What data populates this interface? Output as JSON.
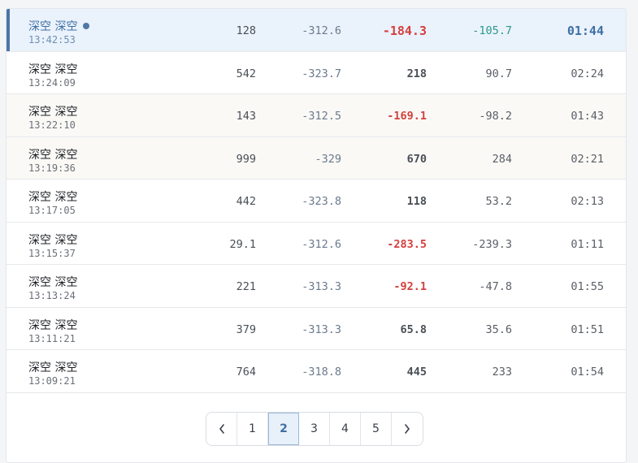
{
  "rows": [
    {
      "name": "深空 深空",
      "time": "13:42:53",
      "c1": "128",
      "c2": "-312.6",
      "c3": "-184.3",
      "c4": "-105.7",
      "c5": "01:44"
    },
    {
      "name": "深空 深空",
      "time": "13:24:09",
      "c1": "542",
      "c2": "-323.7",
      "c3": "218",
      "c4": "90.7",
      "c5": "02:24"
    },
    {
      "name": "深空 深空",
      "time": "13:22:10",
      "c1": "143",
      "c2": "-312.5",
      "c3": "-169.1",
      "c4": "-98.2",
      "c5": "01:43"
    },
    {
      "name": "深空 深空",
      "time": "13:19:36",
      "c1": "999",
      "c2": "-329",
      "c3": "670",
      "c4": "284",
      "c5": "02:21"
    },
    {
      "name": "深空 深空",
      "time": "13:17:05",
      "c1": "442",
      "c2": "-323.8",
      "c3": "118",
      "c4": "53.2",
      "c5": "02:13"
    },
    {
      "name": "深空 深空",
      "time": "13:15:37",
      "c1": "29.1",
      "c2": "-312.6",
      "c3": "-283.5",
      "c4": "-239.3",
      "c5": "01:11"
    },
    {
      "name": "深空 深空",
      "time": "13:13:24",
      "c1": "221",
      "c2": "-313.3",
      "c3": "-92.1",
      "c4": "-47.8",
      "c5": "01:55"
    },
    {
      "name": "深空 深空",
      "time": "13:11:21",
      "c1": "379",
      "c2": "-313.3",
      "c3": "65.8",
      "c4": "35.6",
      "c5": "01:51"
    },
    {
      "name": "深空 深空",
      "time": "13:09:21",
      "c1": "764",
      "c2": "-318.8",
      "c3": "445",
      "c4": "233",
      "c5": "01:54"
    }
  ],
  "pagination": {
    "prev_icon": "chevron-left-icon",
    "next_icon": "chevron-right-icon",
    "pages": [
      "1",
      "2",
      "3",
      "4",
      "5"
    ],
    "current": "2"
  },
  "colors": {
    "accent": "#4a76a8",
    "negative": "#d3403d",
    "teal": "#2b9a8a"
  }
}
